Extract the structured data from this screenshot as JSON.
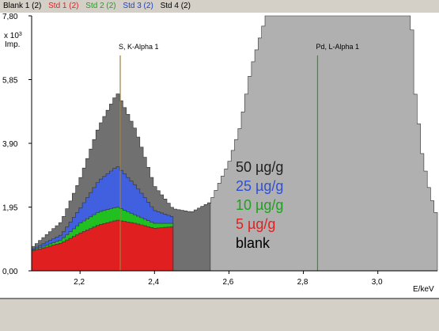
{
  "legend": [
    {
      "label": "Blank 1 (2)",
      "color": "#000000"
    },
    {
      "label": "Std 1 (2)",
      "color": "#e02020"
    },
    {
      "label": "Std 2 (2)",
      "color": "#20a020"
    },
    {
      "label": "Std 3 (2)",
      "color": "#2040c0"
    },
    {
      "label": "Std 4 (2)",
      "color": "#000000"
    }
  ],
  "chart_data": {
    "type": "area",
    "xlabel": "E/keV",
    "ylabel": "Imp.",
    "y_multiplier": "x 10",
    "y_multiplier_exp": "3",
    "xlim": [
      2.07,
      3.16
    ],
    "ylim": [
      0,
      7.8
    ],
    "x_ticks": [
      {
        "value": 2.2,
        "label": "2,2"
      },
      {
        "value": 2.4,
        "label": "2,4"
      },
      {
        "value": 2.6,
        "label": "2,6"
      },
      {
        "value": 2.8,
        "label": "2,8"
      },
      {
        "value": 3.0,
        "label": "3,0"
      }
    ],
    "y_ticks": [
      {
        "value": 0,
        "label": "0,00"
      },
      {
        "value": 1.95,
        "label": "1,95"
      },
      {
        "value": 3.9,
        "label": "3,90"
      },
      {
        "value": 5.85,
        "label": "5,85"
      },
      {
        "value": 7.8,
        "label": "7,80"
      }
    ],
    "annotations": [
      {
        "label": "S, K-Alpha 1",
        "x": 2.308,
        "color": "#a08040"
      },
      {
        "label": "Pd, L-Alpha 1",
        "x": 2.838,
        "color": "#20a020"
      }
    ],
    "series": [
      {
        "name": "blank",
        "color": "#b0b0b0",
        "x": [
          2.07,
          2.15,
          2.2,
          2.25,
          2.3,
          2.35,
          2.4,
          2.45,
          2.5,
          2.55,
          2.6,
          2.63,
          2.66,
          2.7,
          2.8,
          2.9,
          3.0,
          3.05,
          3.09,
          3.1,
          3.12,
          3.14,
          3.16
        ],
        "y": [
          0.6,
          0.75,
          0.9,
          1.0,
          1.1,
          1.1,
          1.15,
          1.3,
          1.55,
          2.1,
          3.3,
          4.4,
          6.2,
          7.8,
          7.8,
          7.8,
          7.8,
          7.8,
          7.8,
          5.5,
          3.5,
          2.4,
          1.6
        ]
      },
      {
        "name": "5 µg/g",
        "color": "#e02020",
        "x": [
          2.07,
          2.15,
          2.2,
          2.25,
          2.3,
          2.35,
          2.4,
          2.45
        ],
        "y": [
          0.6,
          0.85,
          1.15,
          1.4,
          1.55,
          1.45,
          1.3,
          1.35
        ]
      },
      {
        "name": "10 µg/g",
        "color": "#20c020",
        "x": [
          2.07,
          2.15,
          2.2,
          2.25,
          2.3,
          2.35,
          2.4,
          2.45
        ],
        "y": [
          0.62,
          0.95,
          1.45,
          1.8,
          1.95,
          1.7,
          1.45,
          1.45
        ]
      },
      {
        "name": "25 µg/g",
        "color": "#4060e0",
        "x": [
          2.07,
          2.15,
          2.2,
          2.25,
          2.3,
          2.35,
          2.4,
          2.45
        ],
        "y": [
          0.65,
          1.1,
          1.9,
          2.75,
          3.2,
          2.6,
          1.85,
          1.65
        ]
      },
      {
        "name": "50 µg/g",
        "color": "#707070",
        "x": [
          2.07,
          2.15,
          2.2,
          2.25,
          2.3,
          2.35,
          2.4,
          2.45,
          2.5,
          2.55
        ],
        "y": [
          0.7,
          1.5,
          2.8,
          4.4,
          5.45,
          4.3,
          2.6,
          1.9,
          1.8,
          2.1
        ]
      }
    ],
    "series_labels": [
      {
        "label": "50 µg/g",
        "color": "#202020"
      },
      {
        "label": "25 µg/g",
        "color": "#3050d0"
      },
      {
        "label": "10 µg/g",
        "color": "#20a020"
      },
      {
        "label": "5 µg/g",
        "color": "#e02020"
      },
      {
        "label": "blank",
        "color": "#000000"
      }
    ]
  }
}
